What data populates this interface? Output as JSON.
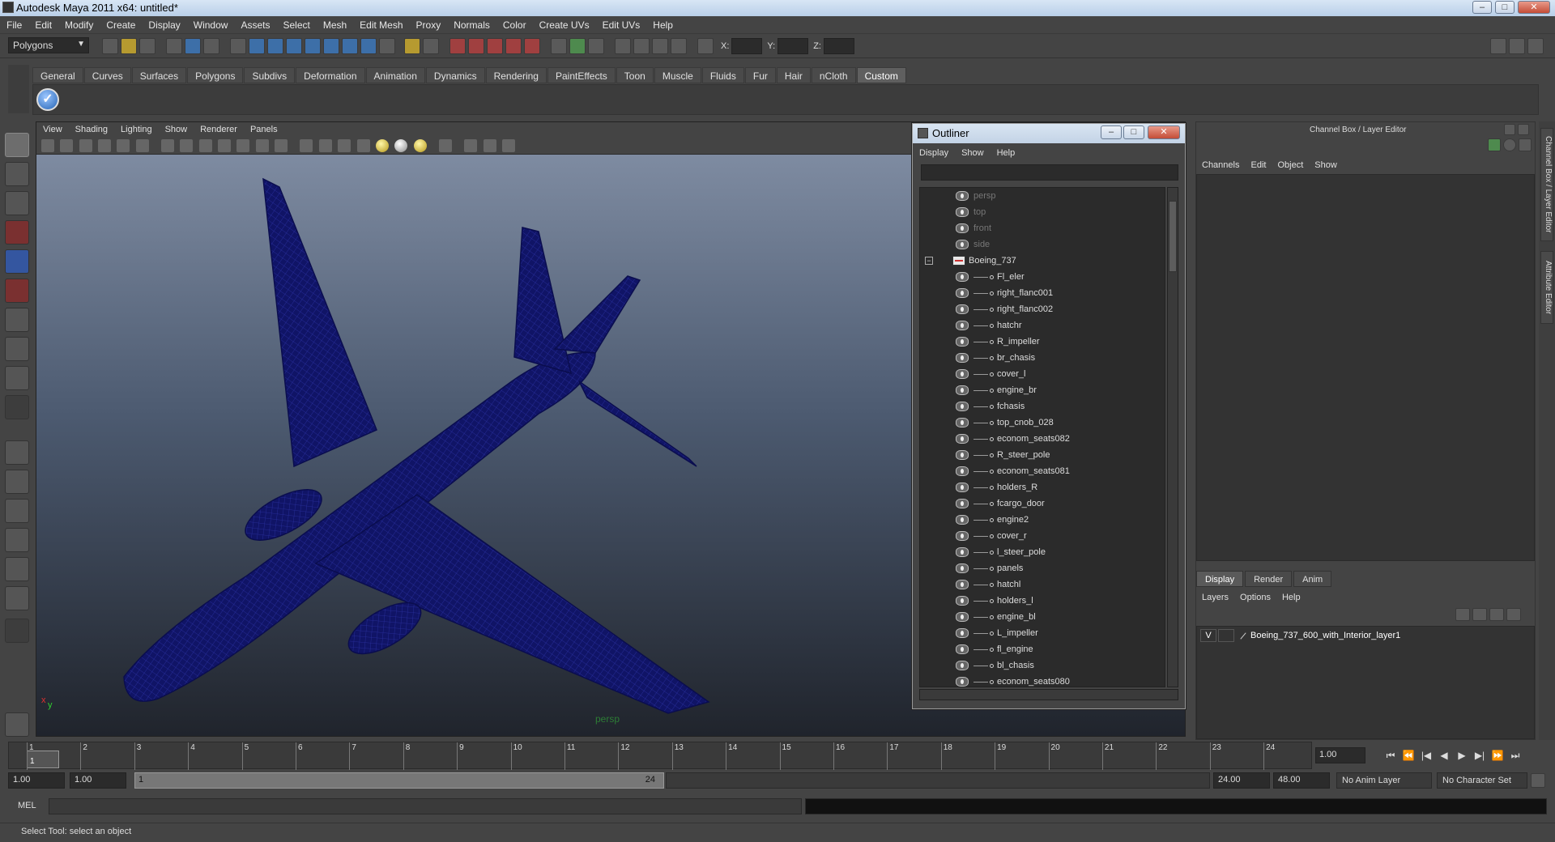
{
  "window": {
    "title": "Autodesk Maya 2011 x64: untitled*"
  },
  "menubar": [
    "File",
    "Edit",
    "Modify",
    "Create",
    "Display",
    "Window",
    "Assets",
    "Select",
    "Mesh",
    "Edit Mesh",
    "Proxy",
    "Normals",
    "Color",
    "Create UVs",
    "Edit UVs",
    "Help"
  ],
  "statusline": {
    "mode": "Polygons",
    "x_label": "X:",
    "y_label": "Y:",
    "z_label": "Z:"
  },
  "shelf": {
    "tabs": [
      "General",
      "Curves",
      "Surfaces",
      "Polygons",
      "Subdivs",
      "Deformation",
      "Animation",
      "Dynamics",
      "Rendering",
      "PaintEffects",
      "Toon",
      "Muscle",
      "Fluids",
      "Fur",
      "Hair",
      "nCloth",
      "Custom"
    ],
    "active": "Custom"
  },
  "viewport": {
    "menu": [
      "View",
      "Shading",
      "Lighting",
      "Show",
      "Renderer",
      "Panels"
    ],
    "camera": "persp",
    "axis_x": "x",
    "axis_y": "y",
    "wire_color": "#0e1068"
  },
  "outliner": {
    "title": "Outliner",
    "menu": [
      "Display",
      "Show",
      "Help"
    ],
    "cameras": [
      "persp",
      "top",
      "front",
      "side"
    ],
    "group": {
      "name": "Boeing_737",
      "expand": "−"
    },
    "items": [
      "Fl_eler",
      "right_flanc001",
      "right_flanc002",
      "hatchr",
      "R_impeller",
      "br_chasis",
      "cover_l",
      "engine_br",
      "fchasis",
      "top_cnob_028",
      "econom_seats082",
      "R_steer_pole",
      "econom_seats081",
      "holders_R",
      "fcargo_door",
      "engine2",
      "cover_r",
      "l_steer_pole",
      "panels",
      "hatchl",
      "holders_l",
      "engine_bl",
      "L_impeller",
      "fl_engine",
      "bl_chasis",
      "econom_seats080"
    ]
  },
  "channelbox": {
    "title": "Channel Box / Layer Editor",
    "menu": [
      "Channels",
      "Edit",
      "Object",
      "Show"
    ],
    "tabs": [
      "Display",
      "Render",
      "Anim"
    ],
    "active_tab": "Display",
    "layer_menu": [
      "Layers",
      "Options",
      "Help"
    ],
    "layer": {
      "visible": "V",
      "name": "Boeing_737_600_with_Interior_layer1"
    }
  },
  "side_tabs": [
    "Channel Box / Layer Editor",
    "Attribute Editor"
  ],
  "timeline": {
    "ticks": [
      "1",
      "2",
      "3",
      "4",
      "5",
      "6",
      "7",
      "8",
      "9",
      "10",
      "11",
      "12",
      "13",
      "14",
      "15",
      "16",
      "17",
      "18",
      "19",
      "20",
      "21",
      "22",
      "23",
      "24"
    ],
    "current_frame": "1",
    "current_field": "1.00"
  },
  "playback": {
    "buttons": [
      "⏮",
      "⏪",
      "|◀",
      "◀",
      "▶",
      "▶|",
      "⏩",
      "⏭"
    ]
  },
  "range": {
    "start": "1.00",
    "start2": "1.00",
    "bar_start": "1",
    "bar_end": "24",
    "end": "24.00",
    "end2": "48.00",
    "anim_layer": "No Anim Layer",
    "char_set": "No Character Set"
  },
  "cmdline": {
    "label": "MEL"
  },
  "helpline": {
    "text": "Select Tool: select an object"
  }
}
